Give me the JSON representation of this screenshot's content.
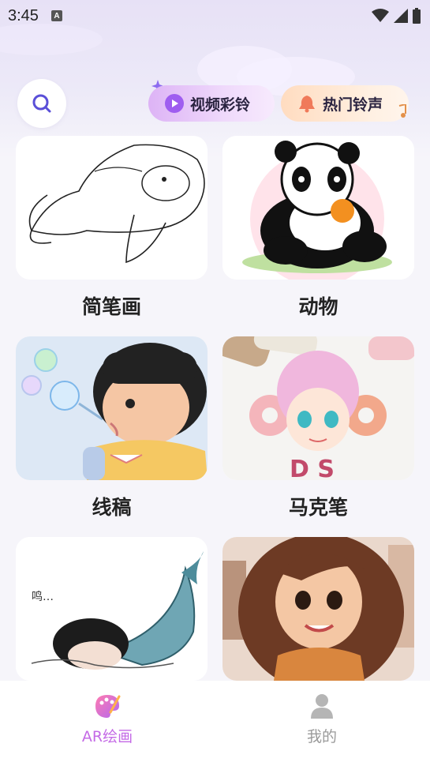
{
  "status_bar": {
    "time": "3:45",
    "notif_letter": "A"
  },
  "header": {
    "search_icon": "search-icon",
    "pills": [
      {
        "label": "视频彩铃",
        "icon": "play-icon",
        "color": "#d9a8f5"
      },
      {
        "label": "热门铃声",
        "icon": "bell-icon",
        "color": "#ffd3b0"
      }
    ]
  },
  "categories": [
    {
      "label": "简笔画"
    },
    {
      "label": "动物"
    },
    {
      "label": "线稿"
    },
    {
      "label": "马克笔"
    },
    {
      "label": ""
    },
    {
      "label": ""
    }
  ],
  "artwork_text": {
    "donut_letters": "D  S",
    "sketch_note": "鸣…"
  },
  "tabbar": {
    "tabs": [
      {
        "label": "AR绘画",
        "icon": "palette-icon",
        "active": true
      },
      {
        "label": "我的",
        "icon": "profile-icon",
        "active": false
      }
    ],
    "accent_color": "#c46ae6"
  }
}
